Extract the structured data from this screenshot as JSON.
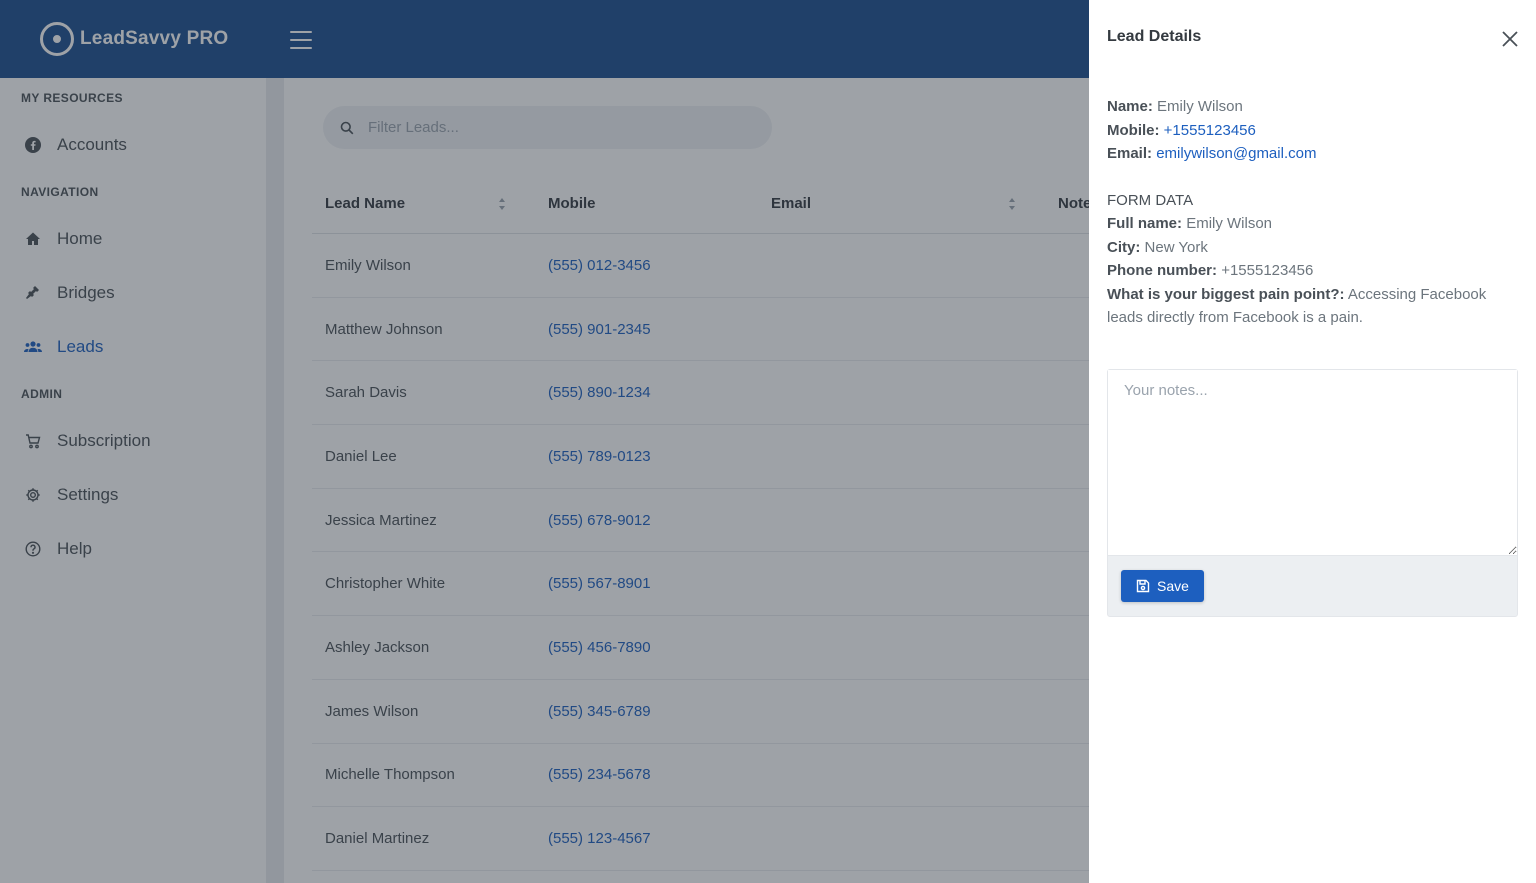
{
  "brand": {
    "name": "LeadSavvy PRO"
  },
  "sidebar": {
    "sections": [
      {
        "title": "MY RESOURCES",
        "items": [
          {
            "label": "Accounts",
            "icon": "facebook-icon"
          }
        ]
      },
      {
        "title": "NAVIGATION",
        "items": [
          {
            "label": "Home",
            "icon": "home-icon"
          },
          {
            "label": "Bridges",
            "icon": "plug-icon"
          },
          {
            "label": "Leads",
            "icon": "users-icon",
            "active": true
          }
        ]
      },
      {
        "title": "ADMIN",
        "items": [
          {
            "label": "Subscription",
            "icon": "cart-icon"
          },
          {
            "label": "Settings",
            "icon": "gear-icon"
          },
          {
            "label": "Help",
            "icon": "help-icon"
          }
        ]
      }
    ]
  },
  "filter": {
    "placeholder": "Filter Leads..."
  },
  "table": {
    "columns": [
      "Lead Name",
      "Mobile",
      "Email",
      "Note"
    ],
    "rows": [
      {
        "name": "Emily Wilson",
        "mobile": "(555) 012-3456"
      },
      {
        "name": "Matthew Johnson",
        "mobile": "(555) 901-2345"
      },
      {
        "name": "Sarah Davis",
        "mobile": "(555) 890-1234"
      },
      {
        "name": "Daniel Lee",
        "mobile": "(555) 789-0123"
      },
      {
        "name": "Jessica Martinez",
        "mobile": "(555) 678-9012"
      },
      {
        "name": "Christopher White",
        "mobile": "(555) 567-8901"
      },
      {
        "name": "Ashley Jackson",
        "mobile": "(555) 456-7890"
      },
      {
        "name": "James Wilson",
        "mobile": "(555) 345-6789"
      },
      {
        "name": "Michelle Thompson",
        "mobile": "(555) 234-5678"
      },
      {
        "name": "Daniel Martinez",
        "mobile": "(555) 123-4567"
      }
    ]
  },
  "drawer": {
    "title": "Lead Details",
    "name_label": "Name:",
    "name": "Emily Wilson",
    "mobile_label": "Mobile:",
    "mobile": "+1555123456",
    "email_label": "Email:",
    "email": "emilywilson@gmail.com",
    "form_heading": "FORM DATA",
    "form": [
      {
        "label": "Full name:",
        "value": "Emily Wilson"
      },
      {
        "label": "City:",
        "value": "New York"
      },
      {
        "label": "Phone number:",
        "value": "+1555123456"
      },
      {
        "label": "What is your biggest pain point?:",
        "value": "Accessing Facebook leads directly from Facebook is a pain."
      }
    ],
    "notes_placeholder": "Your notes...",
    "save_label": "Save"
  },
  "colors": {
    "brand": "#1b4d8e",
    "accent": "#1d5fbf"
  }
}
